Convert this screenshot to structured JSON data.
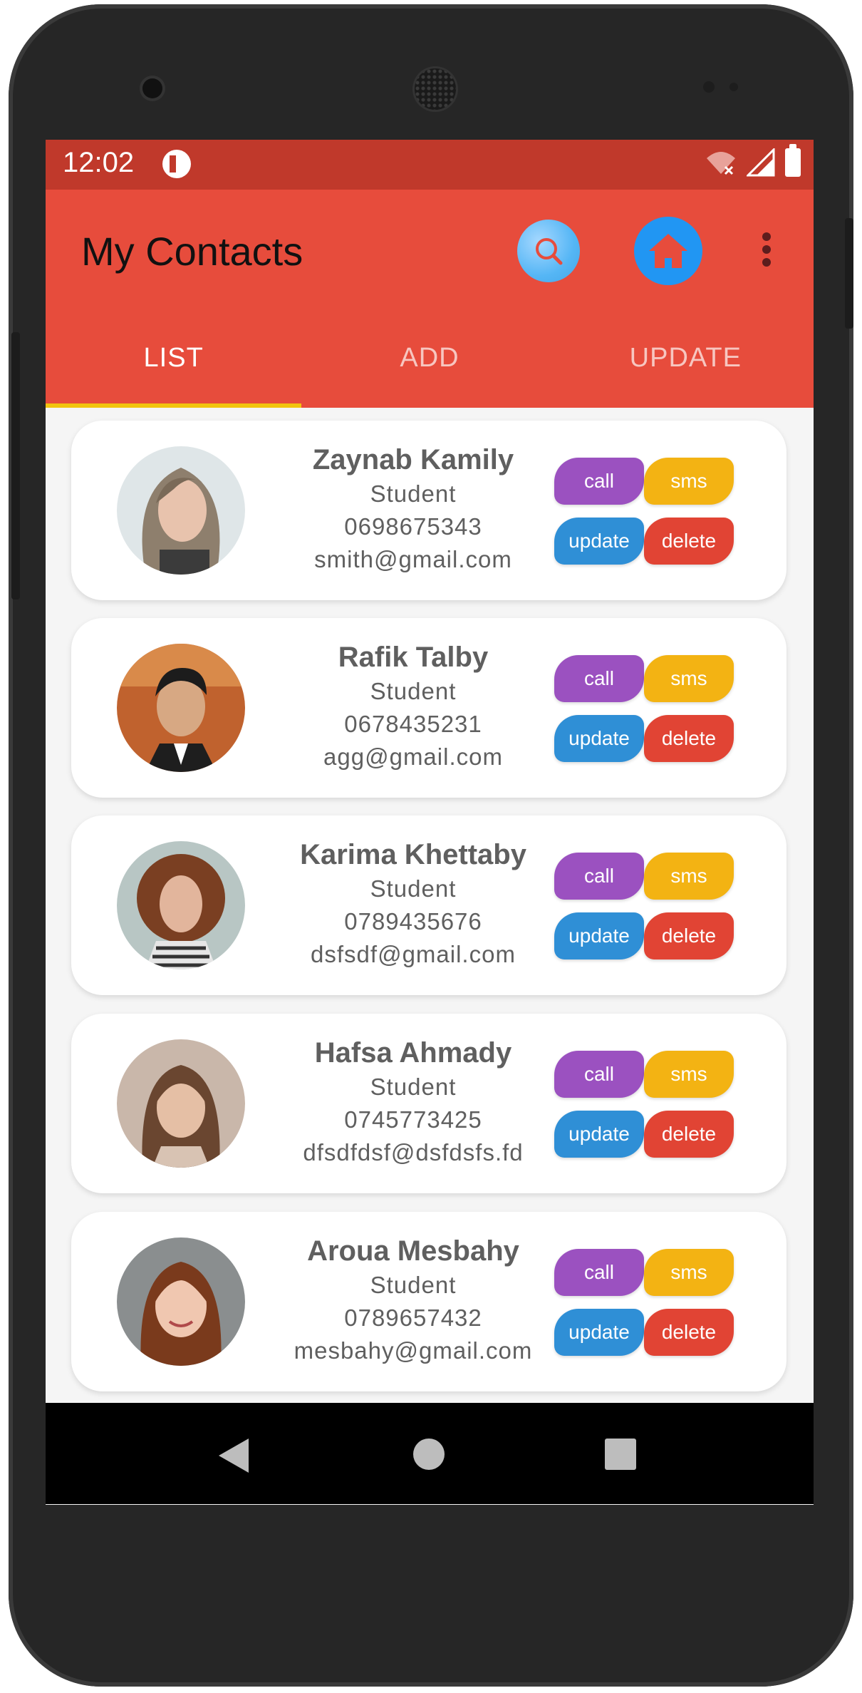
{
  "status_bar": {
    "time": "12:02"
  },
  "app_bar": {
    "title": "My Contacts"
  },
  "tabs": [
    {
      "label": "LIST",
      "active": true
    },
    {
      "label": "ADD",
      "active": false
    },
    {
      "label": "UPDATE",
      "active": false
    }
  ],
  "actions": {
    "call": "call",
    "sms": "sms",
    "update": "update",
    "delete": "delete"
  },
  "contacts": [
    {
      "name": "Zaynab Kamily",
      "role": "Student",
      "phone": "0698675343",
      "email": "smith@gmail.com"
    },
    {
      "name": "Rafik Talby",
      "role": "Student",
      "phone": "0678435231",
      "email": "agg@gmail.com"
    },
    {
      "name": "Karima Khettaby",
      "role": "Student",
      "phone": "0789435676",
      "email": "dsfsdf@gmail.com"
    },
    {
      "name": "Hafsa Ahmady",
      "role": "Student",
      "phone": "0745773425",
      "email": "dfsdfdsf@dsfdsfs.fd"
    },
    {
      "name": "Aroua Mesbahy",
      "role": "Student",
      "phone": "0789657432",
      "email": "mesbahy@gmail.com"
    }
  ],
  "colors": {
    "status_bar": "#c0392b",
    "app_bar": "#e74c3c",
    "tab_indicator": "#f1c40f",
    "call": "#9b51c0",
    "sms": "#f3b313",
    "update": "#2f8fd6",
    "delete": "#e14434"
  },
  "icons": {
    "search": "search-icon",
    "home": "home-icon",
    "more": "more-vert-icon",
    "back": "back-icon",
    "nav_home": "circle-home-icon",
    "recent": "recent-apps-icon"
  }
}
